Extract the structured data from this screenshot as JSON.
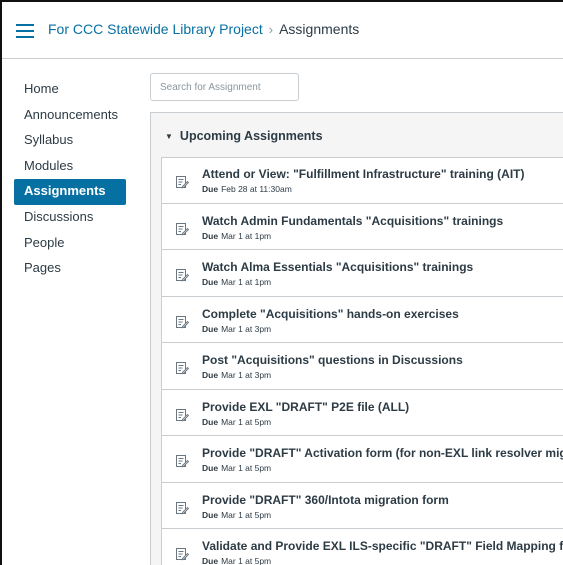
{
  "header": {
    "course_link": "For CCC Statewide Library Project",
    "separator": "›",
    "current_page": "Assignments"
  },
  "nav": {
    "items": [
      {
        "label": "Home"
      },
      {
        "label": "Announcements"
      },
      {
        "label": "Syllabus"
      },
      {
        "label": "Modules"
      },
      {
        "label": "Assignments",
        "active": true
      },
      {
        "label": "Discussions"
      },
      {
        "label": "People"
      },
      {
        "label": "Pages"
      }
    ]
  },
  "search": {
    "placeholder": "Search for Assignment"
  },
  "group": {
    "title": "Upcoming Assignments",
    "due_prefix": "Due",
    "assignments": [
      {
        "title": "Attend or View: \"Fulfillment Infrastructure\" training (AIT)",
        "due": "Feb 28 at 11:30am"
      },
      {
        "title": "Watch Admin Fundamentals \"Acquisitions\" trainings",
        "due": "Mar 1 at 1pm"
      },
      {
        "title": "Watch Alma Essentials \"Acquisitions\" trainings",
        "due": "Mar 1 at 1pm"
      },
      {
        "title": "Complete \"Acquisitions\" hands-on exercises",
        "due": "Mar 1 at 3pm"
      },
      {
        "title": "Post \"Acquisitions\" questions in Discussions",
        "due": "Mar 1 at 3pm"
      },
      {
        "title": "Provide EXL \"DRAFT\" P2E file (ALL)",
        "due": "Mar 1 at 5pm"
      },
      {
        "title": "Provide \"DRAFT\" Activation form (for non-EXL link resolver migrations)",
        "due": "Mar 1 at 5pm"
      },
      {
        "title": "Provide \"DRAFT\" 360/Intota migration form",
        "due": "Mar 1 at 5pm"
      },
      {
        "title": "Validate and Provide EXL ILS-specific \"DRAFT\" Field Mapping form",
        "due": "Mar 1 at 5pm"
      }
    ]
  },
  "icons": {
    "menu": "hamburger-menu-icon",
    "assignment": "assignment-icon",
    "collapse": "caret-down-icon"
  },
  "colors": {
    "link": "#0770a3",
    "active_nav_bg": "#0770a3",
    "text": "#2d3b45",
    "border": "#c7cdd1",
    "group_bg": "#f5f5f5"
  }
}
